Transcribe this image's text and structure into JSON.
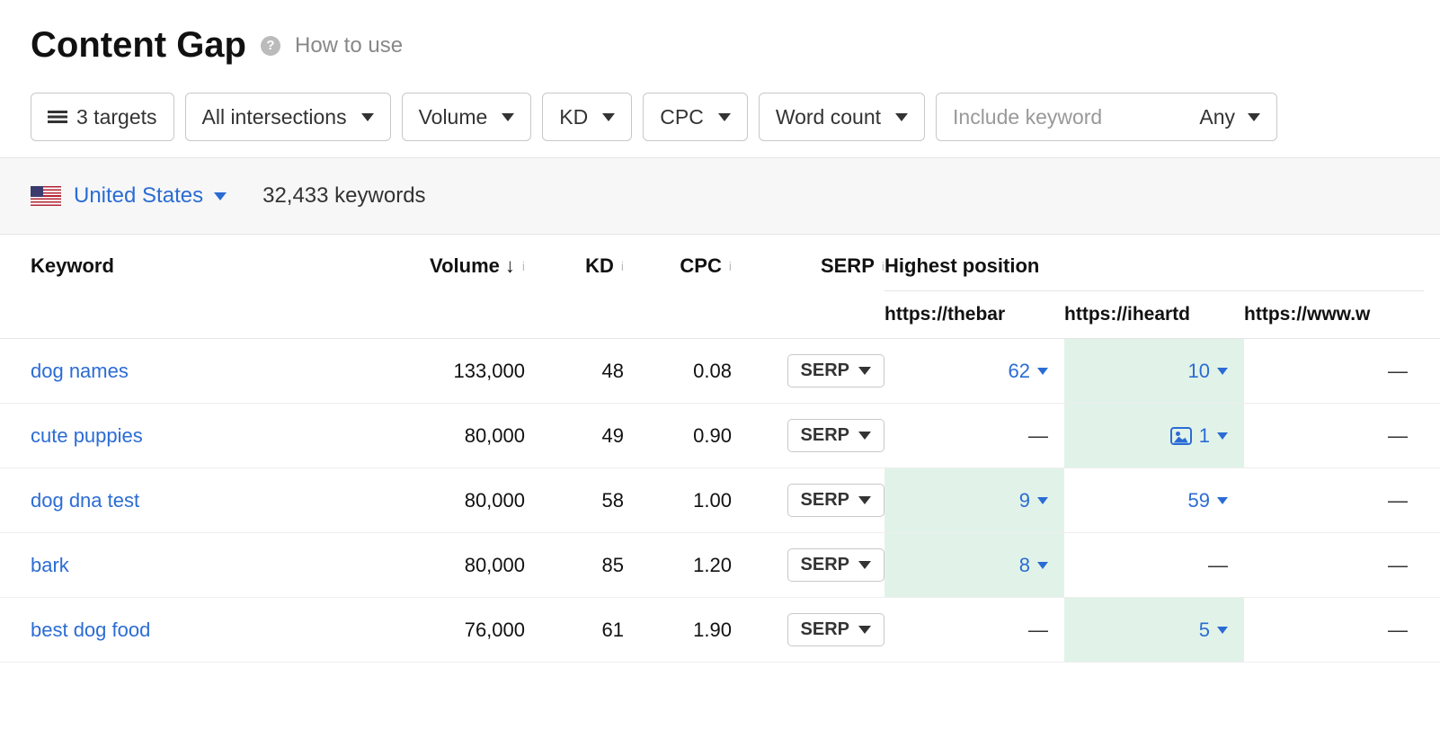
{
  "header": {
    "title": "Content Gap",
    "how_to_use": "How to use"
  },
  "filters": {
    "targets": "3 targets",
    "intersections": "All intersections",
    "volume": "Volume",
    "kd": "KD",
    "cpc": "CPC",
    "word_count": "Word count",
    "include_placeholder": "Include keyword",
    "include_any": "Any"
  },
  "country_bar": {
    "country": "United States",
    "keyword_count": "32,433 keywords"
  },
  "columns": {
    "keyword": "Keyword",
    "volume": "Volume",
    "kd": "KD",
    "cpc": "CPC",
    "serp": "SERP",
    "highest_position": "Highest position",
    "targets": [
      "https://thebar",
      "https://iheartd",
      "https://www.w"
    ]
  },
  "serp_btn_label": "SERP",
  "rows": [
    {
      "keyword": "dog names",
      "volume": "133,000",
      "kd": "48",
      "cpc": "0.08",
      "pos": [
        {
          "value": "62",
          "highlight": false,
          "image": false
        },
        {
          "value": "10",
          "highlight": true,
          "image": false
        },
        {
          "value": null,
          "highlight": false,
          "image": false
        }
      ]
    },
    {
      "keyword": "cute puppies",
      "volume": "80,000",
      "kd": "49",
      "cpc": "0.90",
      "pos": [
        {
          "value": null,
          "highlight": false,
          "image": false
        },
        {
          "value": "1",
          "highlight": true,
          "image": true
        },
        {
          "value": null,
          "highlight": false,
          "image": false
        }
      ]
    },
    {
      "keyword": "dog dna test",
      "volume": "80,000",
      "kd": "58",
      "cpc": "1.00",
      "pos": [
        {
          "value": "9",
          "highlight": true,
          "image": false
        },
        {
          "value": "59",
          "highlight": false,
          "image": false
        },
        {
          "value": null,
          "highlight": false,
          "image": false
        }
      ]
    },
    {
      "keyword": "bark",
      "volume": "80,000",
      "kd": "85",
      "cpc": "1.20",
      "pos": [
        {
          "value": "8",
          "highlight": true,
          "image": false
        },
        {
          "value": null,
          "highlight": false,
          "image": false
        },
        {
          "value": null,
          "highlight": false,
          "image": false
        }
      ]
    },
    {
      "keyword": "best dog food",
      "volume": "76,000",
      "kd": "61",
      "cpc": "1.90",
      "pos": [
        {
          "value": null,
          "highlight": false,
          "image": false
        },
        {
          "value": "5",
          "highlight": true,
          "image": false
        },
        {
          "value": null,
          "highlight": false,
          "image": false
        }
      ]
    }
  ]
}
